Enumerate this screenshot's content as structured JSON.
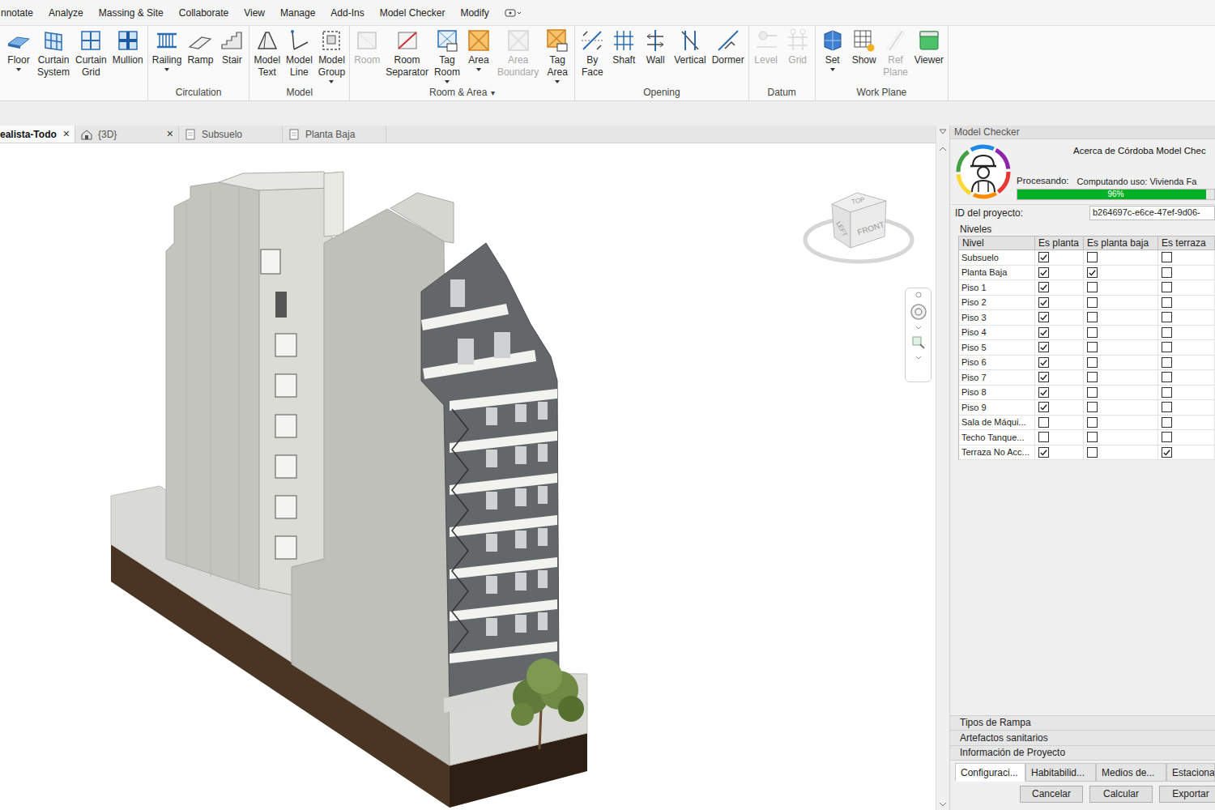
{
  "menu_tabs": [
    "nnotate",
    "Analyze",
    "Massing & Site",
    "Collaborate",
    "View",
    "Manage",
    "Add-Ins",
    "Model Checker",
    "Modify"
  ],
  "ribbon": {
    "groups": [
      {
        "buttons": [
          {
            "lines": [
              "Floor"
            ],
            "dropdown": true,
            "disabled": false
          },
          {
            "lines": [
              "Curtain",
              "System"
            ],
            "dropdown": false,
            "disabled": false
          },
          {
            "lines": [
              "Curtain",
              "Grid"
            ],
            "dropdown": false,
            "disabled": false
          },
          {
            "lines": [
              "Mullion"
            ],
            "dropdown": false,
            "disabled": false
          }
        ]
      },
      {
        "label": "Circulation",
        "buttons": [
          {
            "lines": [
              "Railing"
            ],
            "dropdown": true,
            "disabled": false
          },
          {
            "lines": [
              "Ramp"
            ],
            "dropdown": false,
            "disabled": false
          },
          {
            "lines": [
              "Stair"
            ],
            "dropdown": false,
            "disabled": false
          }
        ]
      },
      {
        "label": "Model",
        "buttons": [
          {
            "lines": [
              "Model",
              "Text"
            ],
            "dropdown": false,
            "disabled": false
          },
          {
            "lines": [
              "Model",
              "Line"
            ],
            "dropdown": false,
            "disabled": false
          },
          {
            "lines": [
              "Model",
              "Group"
            ],
            "dropdown": true,
            "disabled": false
          }
        ]
      },
      {
        "label": "Room & Area",
        "expander": "▾",
        "buttons": [
          {
            "lines": [
              "Room"
            ],
            "dropdown": false,
            "disabled": true
          },
          {
            "lines": [
              "Room",
              "Separator"
            ],
            "dropdown": false,
            "disabled": false
          },
          {
            "lines": [
              "Tag",
              "Room"
            ],
            "dropdown": true,
            "disabled": false
          },
          {
            "lines": [
              "Area"
            ],
            "dropdown": true,
            "disabled": false
          },
          {
            "lines": [
              "Area",
              "Boundary"
            ],
            "dropdown": false,
            "disabled": true
          },
          {
            "lines": [
              "Tag",
              "Area"
            ],
            "dropdown": true,
            "disabled": false
          }
        ]
      },
      {
        "label": "Opening",
        "buttons": [
          {
            "lines": [
              "By",
              "Face"
            ],
            "dropdown": false,
            "disabled": false
          },
          {
            "lines": [
              "Shaft"
            ],
            "dropdown": false,
            "disabled": false
          },
          {
            "lines": [
              "Wall"
            ],
            "dropdown": false,
            "disabled": false
          },
          {
            "lines": [
              "Vertical"
            ],
            "dropdown": false,
            "disabled": false
          },
          {
            "lines": [
              "Dormer"
            ],
            "dropdown": false,
            "disabled": false
          }
        ]
      },
      {
        "label": "Datum",
        "buttons": [
          {
            "lines": [
              "Level"
            ],
            "dropdown": false,
            "disabled": true
          },
          {
            "lines": [
              "Grid"
            ],
            "dropdown": false,
            "disabled": true
          }
        ]
      },
      {
        "label": "Work Plane",
        "buttons": [
          {
            "lines": [
              "Set"
            ],
            "dropdown": true,
            "disabled": false
          },
          {
            "lines": [
              "Show"
            ],
            "dropdown": false,
            "disabled": false
          },
          {
            "lines": [
              "Ref",
              "Plane"
            ],
            "dropdown": false,
            "disabled": true
          },
          {
            "lines": [
              "Viewer"
            ],
            "dropdown": false,
            "disabled": false
          }
        ]
      }
    ]
  },
  "view_tabs": [
    {
      "label": "ealista-Todo",
      "close": "×",
      "kind": "render",
      "selected": true
    },
    {
      "label": "{3D}",
      "close": "×",
      "kind": "3d",
      "selected": false
    },
    {
      "label": "Subsuelo",
      "kind": "plan",
      "selected": false
    },
    {
      "label": "Planta Baja",
      "kind": "plan",
      "selected": false
    }
  ],
  "viewcube": {
    "top": "TOP",
    "left": "LEFT",
    "front": "FRONT"
  },
  "panel": {
    "title": "Model Checker",
    "about": "Acerca de Córdoba Model Chec",
    "status_label": "Procesando:",
    "status_text": "Computando uso: Vivienda Fa",
    "progress": {
      "level": 0.96,
      "reading": "96%"
    },
    "project_id": {
      "label": "ID del proyecto:",
      "value": "b264697c-e6ce-47ef-9d06-"
    },
    "levels": {
      "title": "Niveles",
      "columns": [
        "Nivel",
        "Es planta",
        "Es planta baja",
        "Es terraza"
      ],
      "rows": [
        {
          "name": "Subsuelo",
          "checks": [
            true,
            false,
            false
          ]
        },
        {
          "name": "Planta Baja",
          "checks": [
            true,
            true,
            false
          ]
        },
        {
          "name": "Piso 1",
          "checks": [
            true,
            false,
            false
          ]
        },
        {
          "name": "Piso 2",
          "checks": [
            true,
            false,
            false
          ]
        },
        {
          "name": "Piso 3",
          "checks": [
            true,
            false,
            false
          ]
        },
        {
          "name": "Piso 4",
          "checks": [
            true,
            false,
            false
          ]
        },
        {
          "name": "Piso 5",
          "checks": [
            true,
            false,
            false
          ]
        },
        {
          "name": "Piso 6",
          "checks": [
            true,
            false,
            false
          ]
        },
        {
          "name": "Piso 7",
          "checks": [
            true,
            false,
            false
          ]
        },
        {
          "name": "Piso 8",
          "checks": [
            true,
            false,
            false
          ]
        },
        {
          "name": "Piso 9",
          "checks": [
            true,
            false,
            false
          ]
        },
        {
          "name": "Sala de Máqui...",
          "checks": [
            false,
            false,
            false
          ]
        },
        {
          "name": "Techo Tanque...",
          "checks": [
            false,
            false,
            false
          ]
        },
        {
          "name": "Terraza No Acc...",
          "checks": [
            true,
            false,
            true
          ]
        }
      ]
    },
    "sections": [
      "Tipos de Rampa",
      "Artefactos sanitarios",
      "Información de Proyecto"
    ],
    "tabs": [
      {
        "label": "Configuraci...",
        "selected": true
      },
      {
        "label": "Habitabilid...",
        "selected": false
      },
      {
        "label": "Medios de...",
        "selected": false
      },
      {
        "label": "Estaciona",
        "selected": false
      }
    ],
    "buttons": [
      "Cancelar",
      "Calcular",
      "Exportar"
    ]
  }
}
